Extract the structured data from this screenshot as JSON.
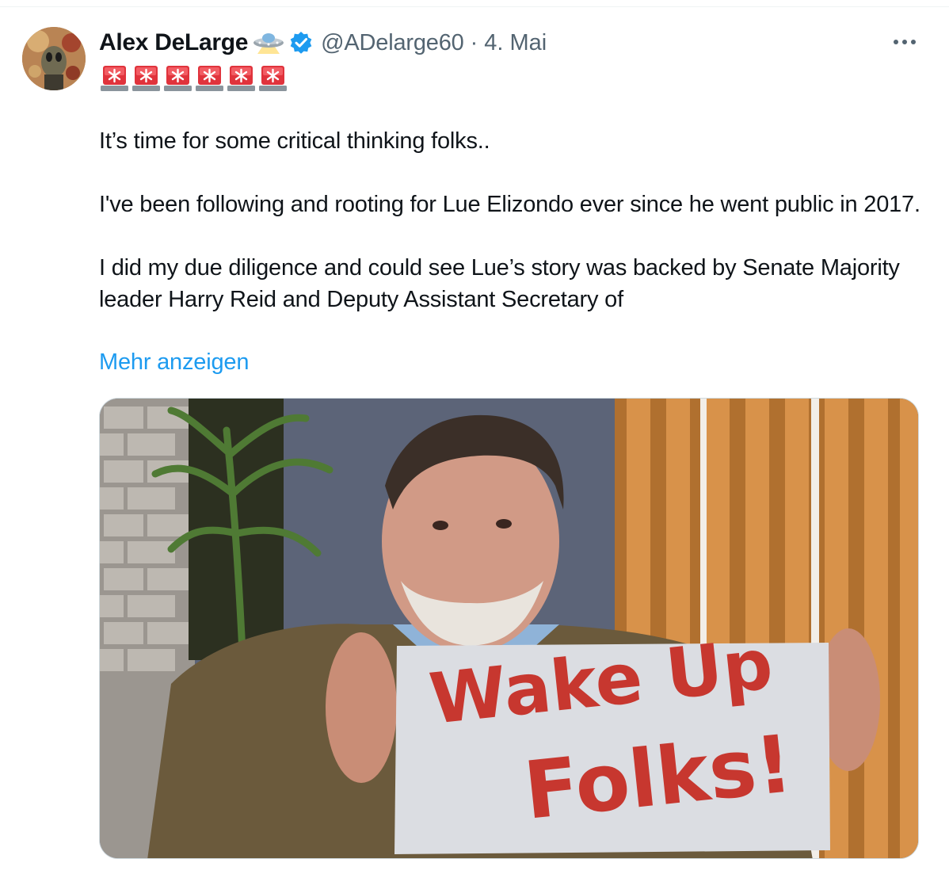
{
  "tweet": {
    "author": {
      "display_name": "Alex DeLarge",
      "handle": "@ADelarge60",
      "verified": true
    },
    "separator": "·",
    "timestamp": "4. Mai",
    "header_icons": [
      "ufo-icon",
      "verified-badge-icon"
    ],
    "status_emojis": [
      "siren-icon",
      "siren-icon",
      "siren-icon",
      "siren-icon",
      "siren-icon",
      "siren-icon"
    ],
    "text": {
      "line1": "It’s time for some critical thinking folks..",
      "line2": "I've been following and rooting for Lue Elizondo ever since he went public in 2017.",
      "line3": "I did my due diligence and could see Lue’s story was backed by Senate Majority leader Harry Reid and Deputy Assistant Secretary of"
    },
    "show_more_label": "Mehr anzeigen",
    "media": {
      "banner_line1": "Wake Up",
      "banner_line2": "Folks!"
    }
  },
  "colors": {
    "text_primary": "#0f1419",
    "text_secondary": "#536471",
    "link": "#1d9bf0",
    "verified": "#1d9bf0",
    "banner_text": "#c7372f"
  }
}
